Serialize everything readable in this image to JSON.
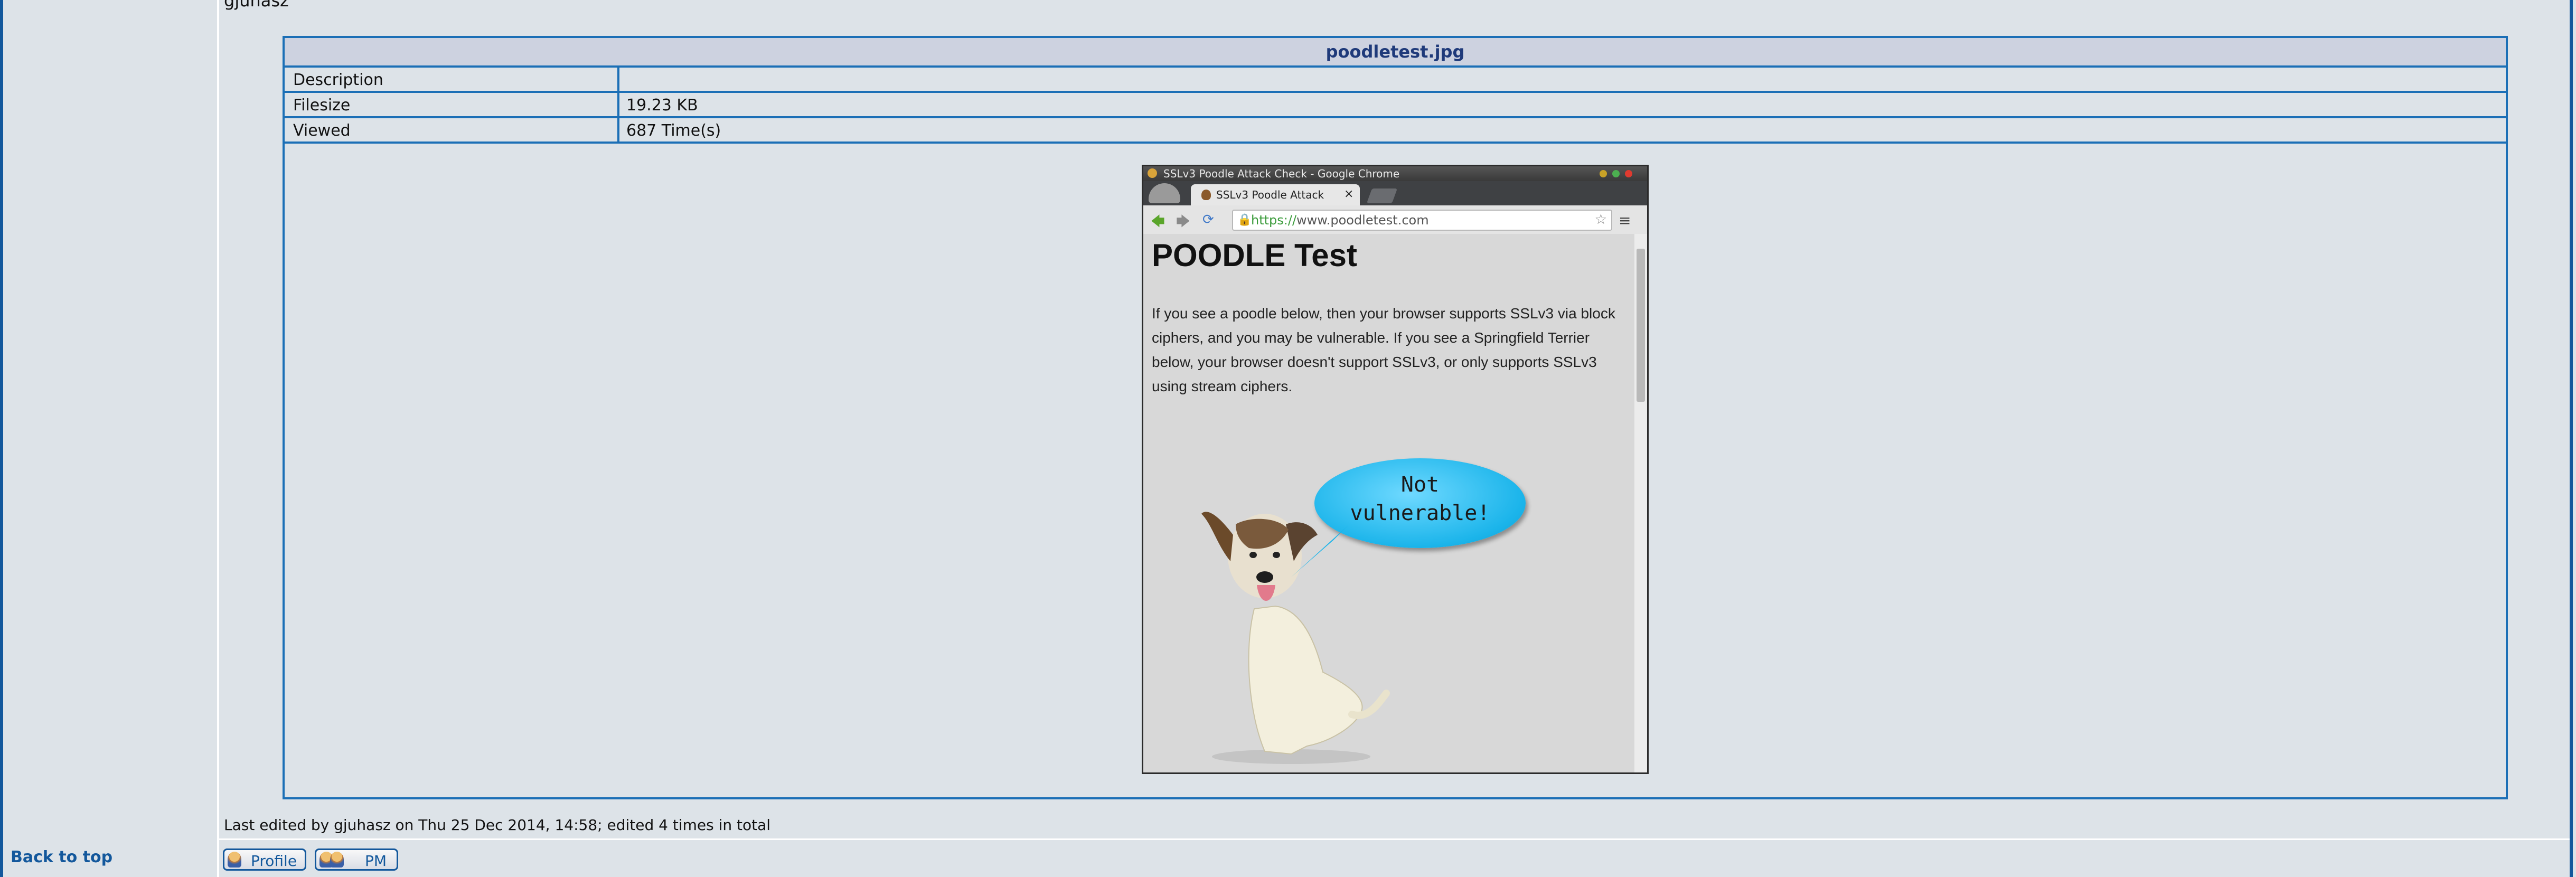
{
  "post": {
    "author": "gjuhasz",
    "edited_note": "Last edited by gjuhasz on Thu 25 Dec 2014, 14:58; edited 4 times in total"
  },
  "attachment": {
    "filename": "poodletest.jpg",
    "rows": [
      {
        "label": "Description",
        "value": ""
      },
      {
        "label": "Filesize",
        "value": "19.23 KB"
      },
      {
        "label": "Viewed",
        "value": "687 Time(s)"
      }
    ]
  },
  "screenshot": {
    "window_title": "SSLv3 Poodle Attack Check - Google Chrome",
    "tab_label": "SSLv3 Poodle Attack",
    "tab_close": "×",
    "url_scheme": "https://",
    "url_host": "www.poodletest.com",
    "heading": "POODLE Test",
    "paragraph": "If you see a poodle below, then your browser supports SSLv3 via block ciphers, and you may be vulnerable. If you see a Springfield Terrier below, your browser doesn't support SSLv3, or only supports SSLv3 using stream ciphers.",
    "bubble_line1": "Not",
    "bubble_line2": "vulnerable!"
  },
  "footer": {
    "back_to_top": "Back to top",
    "profile_label": "Profile",
    "pm_label": "PM"
  },
  "icons": {
    "back": "back-arrow-icon",
    "forward": "forward-arrow-icon",
    "reload": "reload-icon",
    "lock": "lock-icon",
    "star": "star-icon",
    "menu": "hamburger-menu-icon"
  },
  "colors": {
    "border": "#1b6fb6",
    "link": "#13589c",
    "background": "#dde3e8"
  }
}
